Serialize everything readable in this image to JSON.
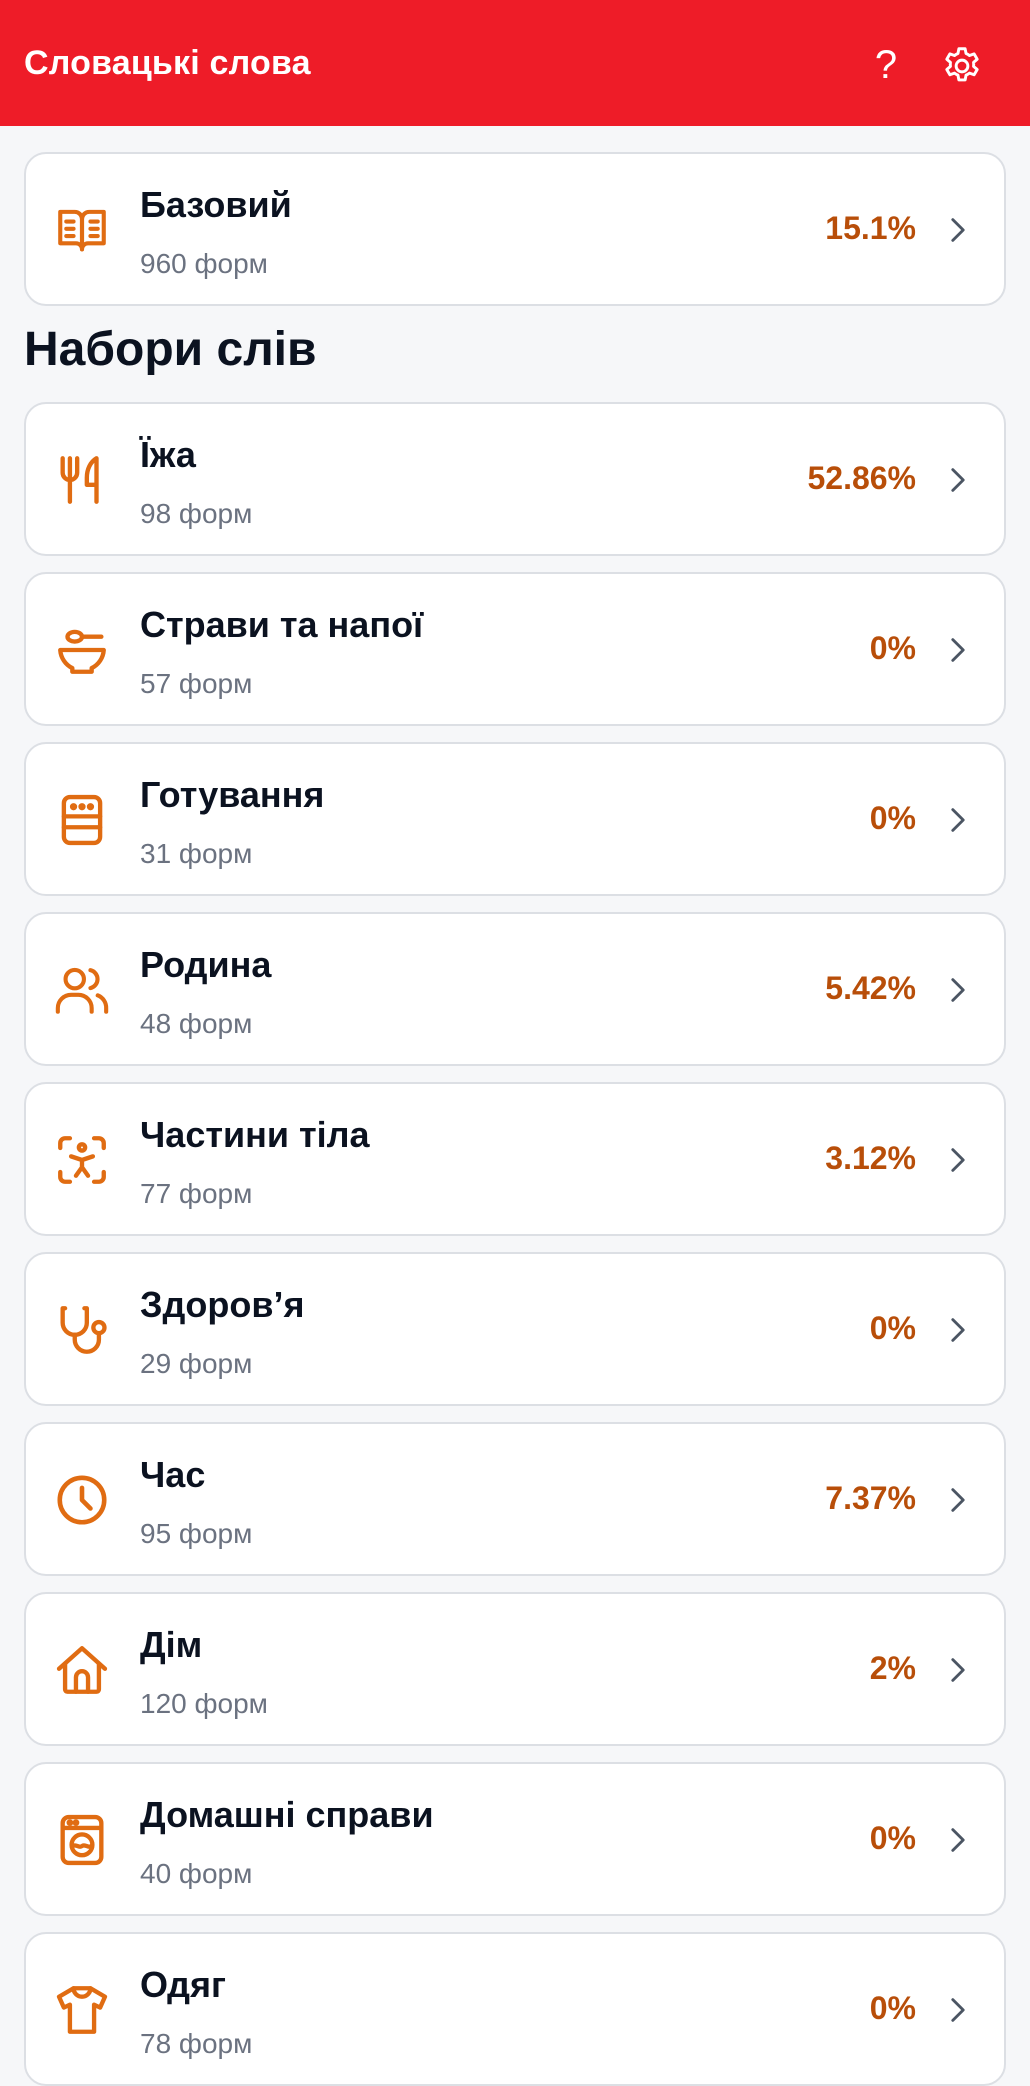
{
  "header": {
    "title": "Словацькі слова",
    "help_label": "?"
  },
  "base": {
    "title": "Базовий",
    "count": "960 форм",
    "percent": "15.1%",
    "icon": "open-book-icon"
  },
  "section_title": "Набори слів",
  "sets": [
    {
      "title": "Їжа",
      "count": "98 форм",
      "percent": "52.86%",
      "icon": "fork-knife-icon"
    },
    {
      "title": "Страви та напої",
      "count": "57 форм",
      "percent": "0%",
      "icon": "bowl-icon"
    },
    {
      "title": "Готування",
      "count": "31 форм",
      "percent": "0%",
      "icon": "oven-icon"
    },
    {
      "title": "Родина",
      "count": "48 форм",
      "percent": "5.42%",
      "icon": "people-icon"
    },
    {
      "title": "Частини тіла",
      "count": "77 форм",
      "percent": "3.12%",
      "icon": "body-scan-icon"
    },
    {
      "title": "Здоров’я",
      "count": "29 форм",
      "percent": "0%",
      "icon": "stethoscope-icon"
    },
    {
      "title": "Час",
      "count": "95 форм",
      "percent": "7.37%",
      "icon": "clock-icon"
    },
    {
      "title": "Дім",
      "count": "120 форм",
      "percent": "2%",
      "icon": "house-icon"
    },
    {
      "title": "Домашні справи",
      "count": "40 форм",
      "percent": "0%",
      "icon": "washing-machine-icon"
    },
    {
      "title": "Одяг",
      "count": "78 форм",
      "percent": "0%",
      "icon": "t-shirt-icon"
    }
  ],
  "colors": {
    "header_bg": "#ee1c28",
    "accent_icon": "#e06c12",
    "percent": "#b84e09",
    "chevron": "#4b5563"
  }
}
